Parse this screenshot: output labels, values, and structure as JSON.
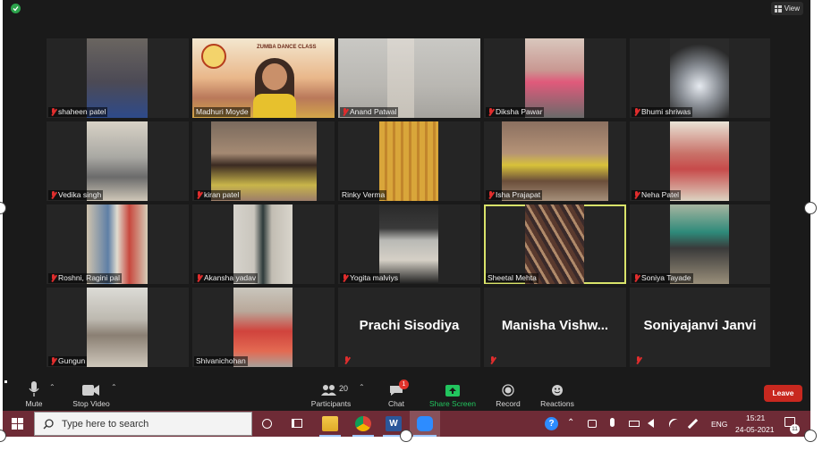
{
  "meeting": {
    "view_label": "View",
    "participants": [
      {
        "name": "shaheen patel",
        "muted": true
      },
      {
        "name": "Madhuri Moyde",
        "muted": false,
        "banner_title": "ZUMBA DANCE CLASS"
      },
      {
        "name": "Anand Patwal",
        "muted": true
      },
      {
        "name": "Diksha Pawar",
        "muted": true
      },
      {
        "name": "Bhumi shriwas",
        "muted": true
      },
      {
        "name": "Vedika singh",
        "muted": true
      },
      {
        "name": "kiran patel",
        "muted": true
      },
      {
        "name": "Rinky Verma",
        "muted": false
      },
      {
        "name": "Isha Prajapat",
        "muted": true
      },
      {
        "name": "Neha Patel",
        "muted": true
      },
      {
        "name": "Roshni, Ragini pal",
        "muted": true
      },
      {
        "name": "Akansha yadav",
        "muted": true
      },
      {
        "name": "Yogita malviys",
        "muted": true
      },
      {
        "name": "Sheetal Mehta",
        "muted": false,
        "active_speaker": true
      },
      {
        "name": "Soniya Tayade",
        "muted": true
      },
      {
        "name": "Gungun",
        "muted": true
      },
      {
        "name": "Shivanichohan",
        "muted": false
      },
      {
        "name": "Prachi Sisodiya",
        "muted": true,
        "video_off": true
      },
      {
        "name": "Manisha  Vishw...",
        "muted": true,
        "video_off": true
      },
      {
        "name": "Soniyajanvi Janvi",
        "muted": true,
        "video_off": true
      }
    ]
  },
  "toolbar": {
    "mute_label": "Mute",
    "stop_video_label": "Stop Video",
    "participants_label": "Participants",
    "participants_count": "20",
    "chat_label": "Chat",
    "chat_badge": "1",
    "share_screen_label": "Share Screen",
    "record_label": "Record",
    "reactions_label": "Reactions",
    "leave_label": "Leave"
  },
  "taskbar": {
    "search_placeholder": "Type here to search",
    "language": "ENG",
    "time": "15:21",
    "date": "24-05-2021",
    "notification_count": "11"
  },
  "colors": {
    "share_screen": "#22c55e",
    "leave": "#c8281f",
    "active_speaker_border": "#d9e36a",
    "taskbar": "#6e2b36"
  }
}
